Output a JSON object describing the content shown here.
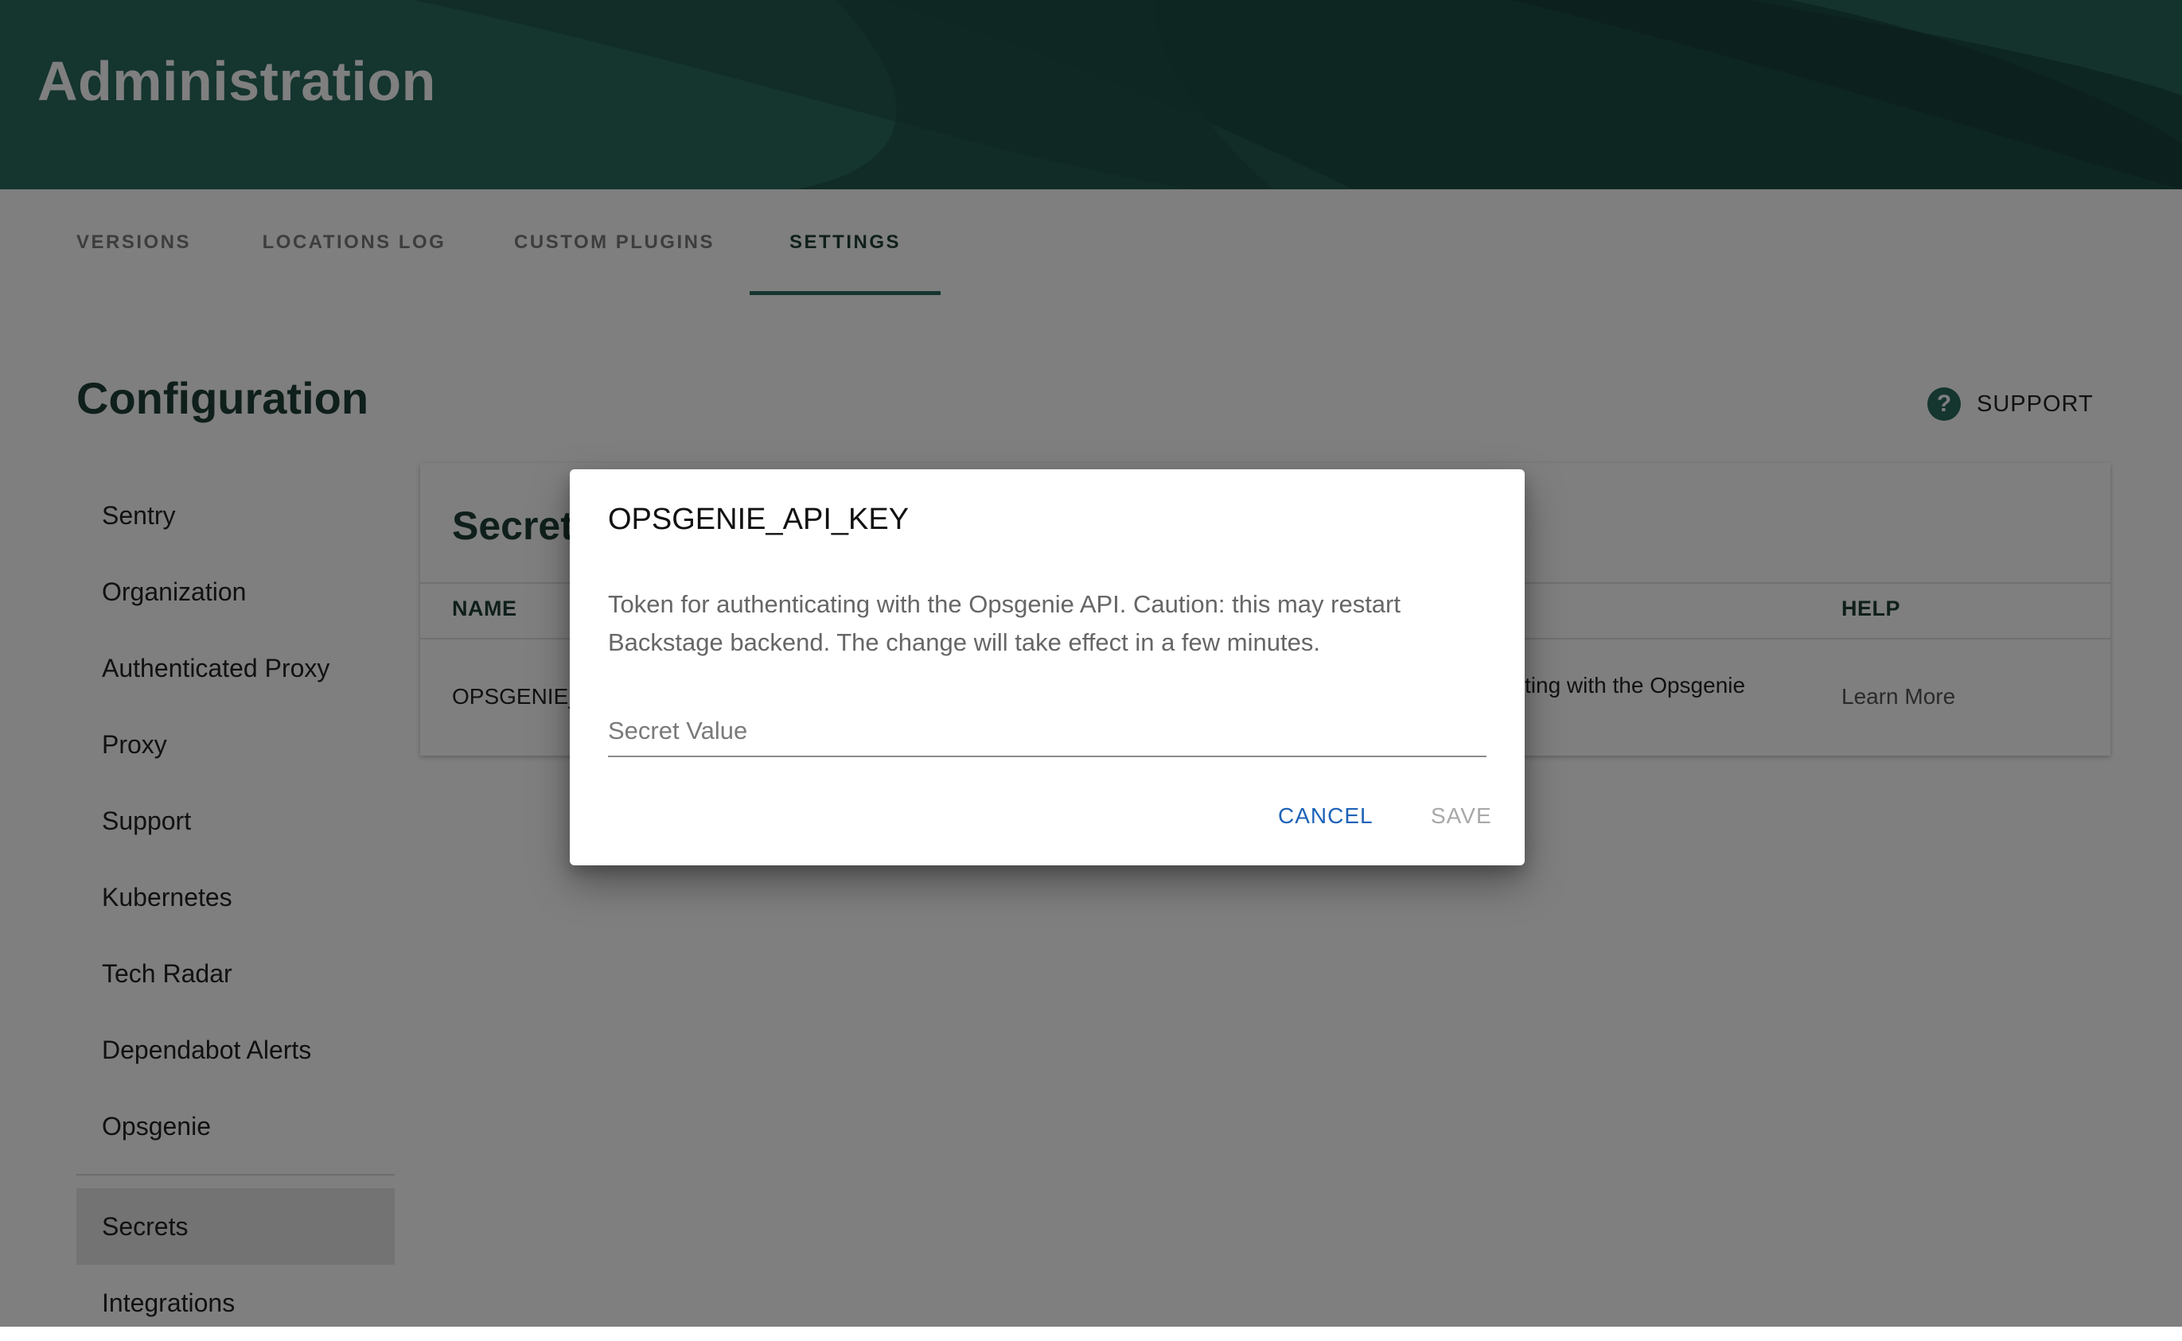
{
  "header": {
    "title": "Administration"
  },
  "tabs": [
    {
      "label": "VERSIONS"
    },
    {
      "label": "LOCATIONS LOG"
    },
    {
      "label": "CUSTOM PLUGINS"
    },
    {
      "label": "SETTINGS",
      "active": true
    }
  ],
  "page": {
    "heading": "Configuration",
    "support_label": "SUPPORT",
    "support_icon": "help-circle-icon"
  },
  "sidebar": {
    "items": [
      {
        "label": "Sentry"
      },
      {
        "label": "Organization"
      },
      {
        "label": "Authenticated Proxy"
      },
      {
        "label": "Proxy"
      },
      {
        "label": "Support"
      },
      {
        "label": "Kubernetes"
      },
      {
        "label": "Tech Radar"
      },
      {
        "label": "Dependabot Alerts"
      },
      {
        "label": "Opsgenie"
      },
      {
        "label": "Secrets",
        "selected": true
      },
      {
        "label": "Integrations"
      }
    ]
  },
  "card": {
    "title": "Secret",
    "columns": {
      "name": "NAME",
      "help": "HELP"
    },
    "row": {
      "name": "OPSGENIE_",
      "description_fragment": "ting with the Opsgenie",
      "help_link": "Learn More"
    }
  },
  "dialog": {
    "title": "OPSGENIE_API_KEY",
    "description": "Token for authenticating with the Opsgenie API. Caution: this may restart Backstage backend. The change will take effect in a few minutes.",
    "input_placeholder": "Secret Value",
    "cancel_label": "CANCEL",
    "save_label": "SAVE"
  },
  "colors": {
    "brand": "#2b6b5e",
    "brand_dark": "#1f3e37",
    "link_blue": "#1e62b8",
    "overlay": "rgba(0,0,0,0.5)"
  }
}
